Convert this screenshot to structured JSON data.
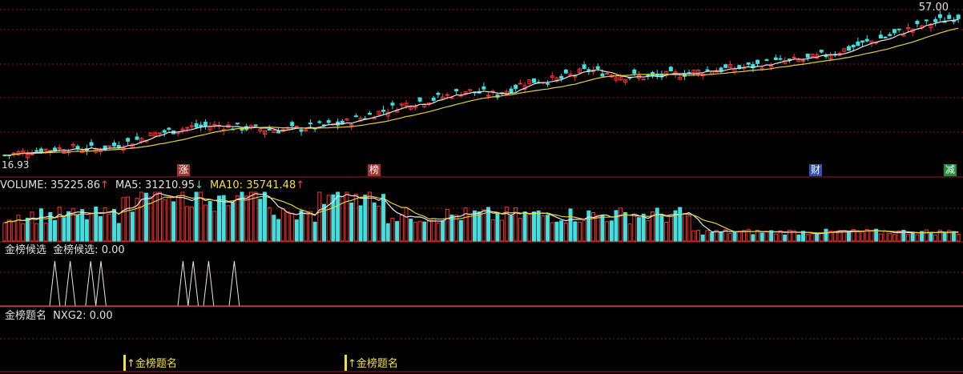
{
  "price_panel": {
    "high_label": "57.00",
    "low_label": "16.93",
    "markers": [
      {
        "text": "涨",
        "color": "#a83232"
      },
      {
        "text": "榜",
        "color": "#a83232"
      },
      {
        "text": "财",
        "color": "#3050c0"
      },
      {
        "text": "减",
        "color": "#209040"
      }
    ]
  },
  "volume_panel": {
    "name": "VOLUME",
    "value": "35225.86",
    "value_arrow": "↑",
    "ma5_label": "MA5:",
    "ma5_value": "31210.95",
    "ma5_arrow": "↓",
    "ma10_label": "MA10:",
    "ma10_value": "35741.48",
    "ma10_arrow": "↑"
  },
  "candidate_panel": {
    "title": "金榜候选",
    "series_label": "金榜候选:",
    "series_value": "0.00"
  },
  "gold_panel": {
    "title": "金榜题名",
    "series_label": "NXG2:",
    "series_value": "0.00",
    "signals": [
      {
        "text": "金榜题名"
      },
      {
        "text": "金榜题名"
      }
    ]
  },
  "colors": {
    "up": "#ff3030",
    "down": "#40e0e0",
    "ma_white": "#e8e8e8",
    "ma_yellow": "#e0d040",
    "grid": "#8b1a1a",
    "signal": "#f0e040"
  },
  "chart_data": [
    {
      "type": "candlestick",
      "title": "",
      "ylim": [
        16.93,
        57.0
      ],
      "note_labels": [
        "57.00",
        "16.93"
      ],
      "trend_close": [
        18.2,
        19.5,
        20.1,
        19.8,
        21.5,
        24.0,
        25.5,
        26.0,
        25.2,
        24.8,
        25.5,
        26.5,
        29.0,
        31.5,
        33.0,
        35.0,
        34.0,
        37.5,
        38.0,
        40.5,
        39.0,
        38.5,
        39.5,
        40.5,
        41.0,
        42.5,
        43.0,
        45.0,
        47.5,
        50.0,
        52.5,
        54.5
      ]
    },
    {
      "type": "bar",
      "title": "VOLUME",
      "series": [
        {
          "name": "VOLUME",
          "values": [
            35225.86
          ]
        },
        {
          "name": "MA5",
          "values": [
            31210.95
          ]
        },
        {
          "name": "MA10",
          "values": [
            35741.48
          ]
        }
      ]
    },
    {
      "type": "line",
      "title": "金榜候选",
      "x": [
        1,
        2,
        3,
        4,
        5,
        6,
        7,
        8,
        9,
        10,
        11,
        12,
        13,
        14,
        15,
        16,
        17,
        18,
        19,
        20,
        21,
        22,
        23,
        24,
        25,
        26,
        27,
        28,
        29,
        30,
        31,
        32,
        33,
        34,
        35,
        36,
        37,
        38,
        39,
        40,
        41,
        42,
        43,
        44,
        45,
        46,
        47,
        48,
        49,
        50,
        51,
        52,
        53,
        54,
        55,
        56,
        57,
        58,
        59,
        60,
        61,
        62,
        63,
        64,
        65,
        66,
        67,
        68,
        69,
        70,
        71,
        72,
        73,
        74,
        75,
        76,
        77,
        78,
        79,
        80
      ],
      "y": [
        0,
        0,
        0,
        0,
        0,
        0,
        1,
        0,
        0,
        1,
        0,
        0,
        0,
        1,
        0,
        1,
        0,
        0,
        0,
        0,
        0,
        0,
        0,
        0,
        0,
        0,
        0,
        0,
        0,
        0,
        0,
        1,
        0,
        1,
        0,
        0,
        1,
        0,
        0,
        0,
        0,
        1,
        0,
        0,
        0,
        0,
        0,
        0,
        0,
        0,
        0,
        0,
        0,
        0,
        0,
        0,
        0,
        0,
        0,
        0,
        0,
        0,
        0,
        0,
        0,
        0,
        0,
        0,
        0,
        0,
        0,
        0,
        0,
        0,
        0,
        0,
        0,
        0,
        0,
        0
      ],
      "ylim": [
        0,
        1
      ]
    }
  ]
}
